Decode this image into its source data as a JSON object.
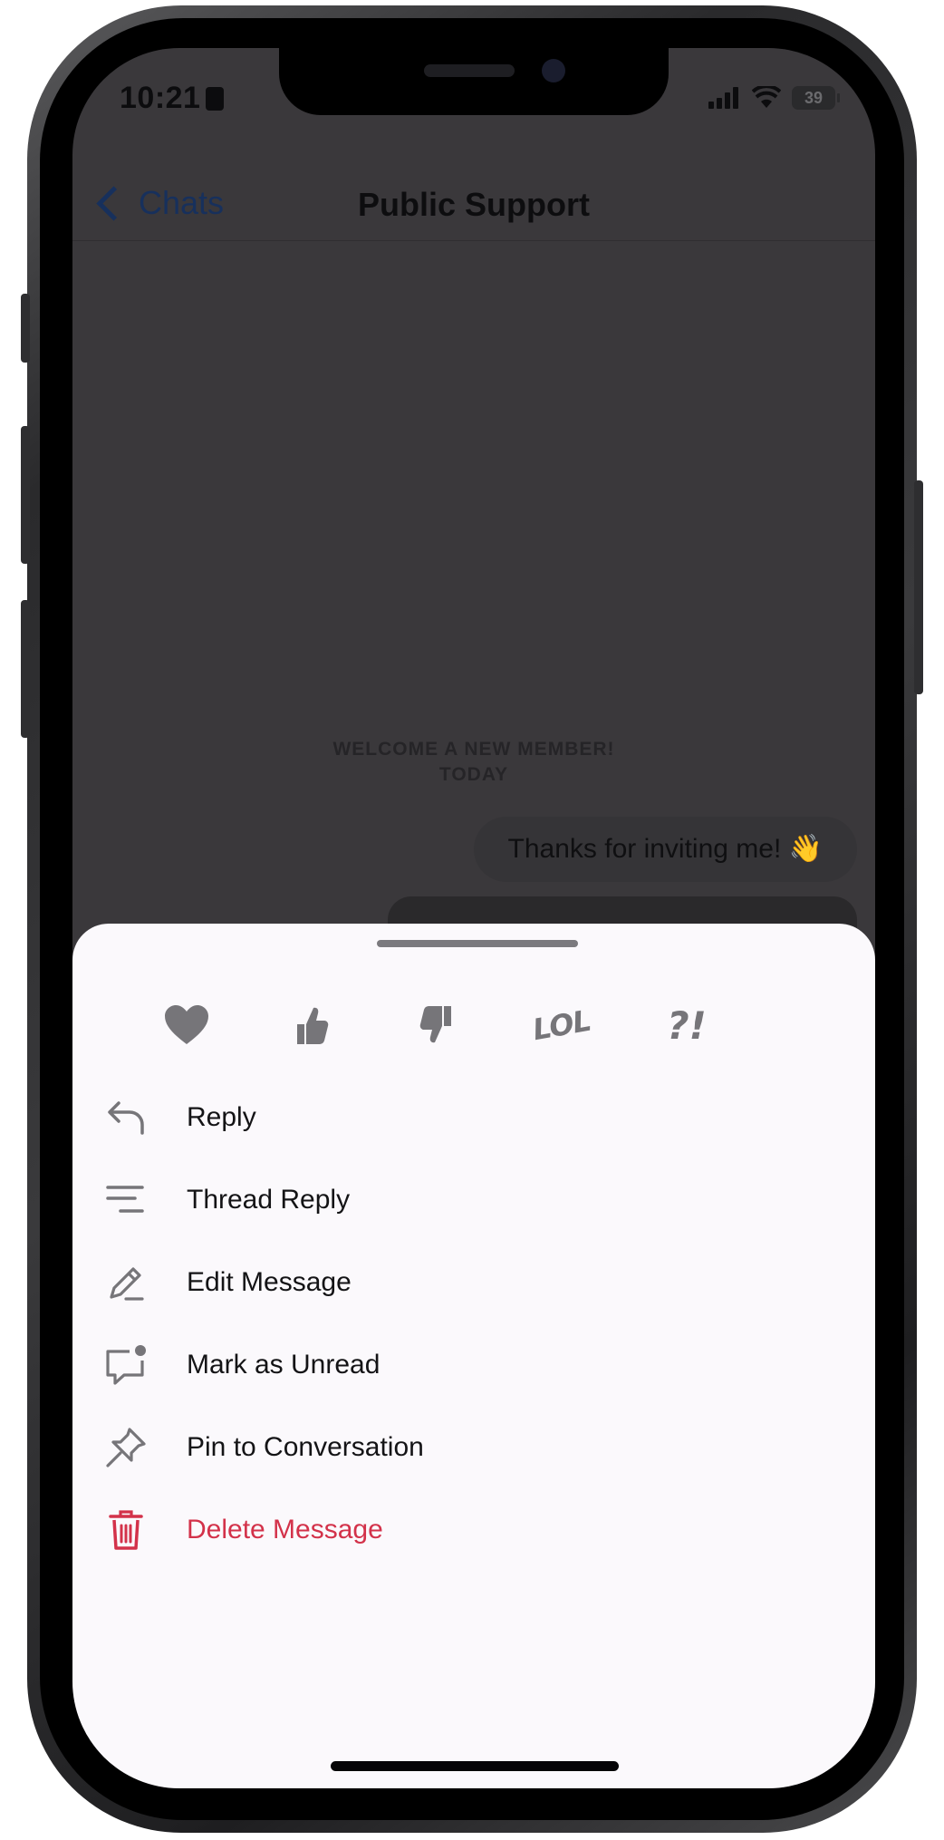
{
  "status_bar": {
    "time": "10:21",
    "battery": "39"
  },
  "nav": {
    "back_label": "Chats",
    "title": "Public Support"
  },
  "chat": {
    "banner_line1": "WELCOME A NEW MEMBER!",
    "banner_line2": "TODAY",
    "message_text": "Thanks for inviting me! 👋"
  },
  "reactions": [
    {
      "name": "heart",
      "icon": "heart-icon"
    },
    {
      "name": "thumbs-up",
      "icon": "thumbs-up-icon"
    },
    {
      "name": "thumbs-down",
      "icon": "thumbs-down-icon"
    },
    {
      "name": "lol",
      "label": "LOL"
    },
    {
      "name": "question-exclamation",
      "label": "?!"
    }
  ],
  "menu": [
    {
      "label": "Reply",
      "icon": "reply-arrow-icon"
    },
    {
      "label": "Thread Reply",
      "icon": "thread-lines-icon"
    },
    {
      "label": "Edit Message",
      "icon": "pencil-icon"
    },
    {
      "label": "Mark as Unread",
      "icon": "unread-bubble-icon"
    },
    {
      "label": "Pin to Conversation",
      "icon": "pin-icon"
    },
    {
      "label": "Delete Message",
      "icon": "trash-icon",
      "danger": true
    }
  ],
  "colors": {
    "accent": "#17305c",
    "danger": "#d3324a",
    "icon": "#767579",
    "sheet_bg": "#fbf9fc"
  }
}
